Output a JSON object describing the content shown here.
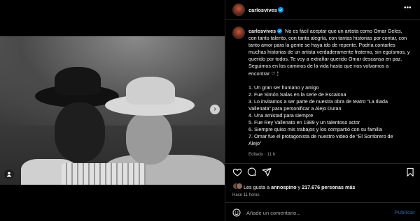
{
  "post": {
    "username": "carlosvives",
    "caption_intro": "No es fácil aceptar que un artista como Omar Geles, con tanto talento, con tanta alegría, con tantas historias por contar, con tanto amor para la gente se haya ido de repente. Podría contarles muchas historias de un artista verdaderamente fraterno, sin egoísmos, y querido por todos. Te voy a extrañar querido Omar descansa en paz. Seguimos en los caminos de la vida hasta que nos volvamos a encontrar ♡ 🕯",
    "caption_list": [
      "1. Un gran ser humano y amigo",
      "2. Fue Simón Salas en la serie de Escalona",
      "3. Lo invitamos a ser parte de nuestra obra de teatro “La Iliada",
      "Vallenata” para personificar a Alejo Duran",
      "4. Una amistad para siempre",
      "5. Fue Rey Vallenato en 1989 y un talentoso actor",
      "6. Siempre quiso mis trabajos y los compartió con su familia",
      "7. Omar fue el protagonista de nuestro video de “El Sombrero de",
      "Alejo”"
    ],
    "edited_label": "Editado · 11 h",
    "likes_prefix": "Les gusta a ",
    "likes_user": "annospino",
    "likes_middle": " y ",
    "likes_count": "217.676 personas más",
    "time_ago": "Hace 11 horas"
  },
  "comment": {
    "placeholder": "Añade un comentario...",
    "publish_label": "Publicar"
  },
  "icons": {
    "more": "more-horizontal-icon",
    "like": "heart-icon",
    "comment": "comment-bubble-icon",
    "share": "send-icon",
    "save": "bookmark-icon",
    "emoji": "smiley-icon",
    "next": "chevron-right-icon",
    "tags": "user-tag-icon"
  },
  "colors": {
    "background": "#000000",
    "verified": "#0095f6",
    "muted_text": "#a8a8a8",
    "publish_disabled": "#1f4f7a"
  }
}
